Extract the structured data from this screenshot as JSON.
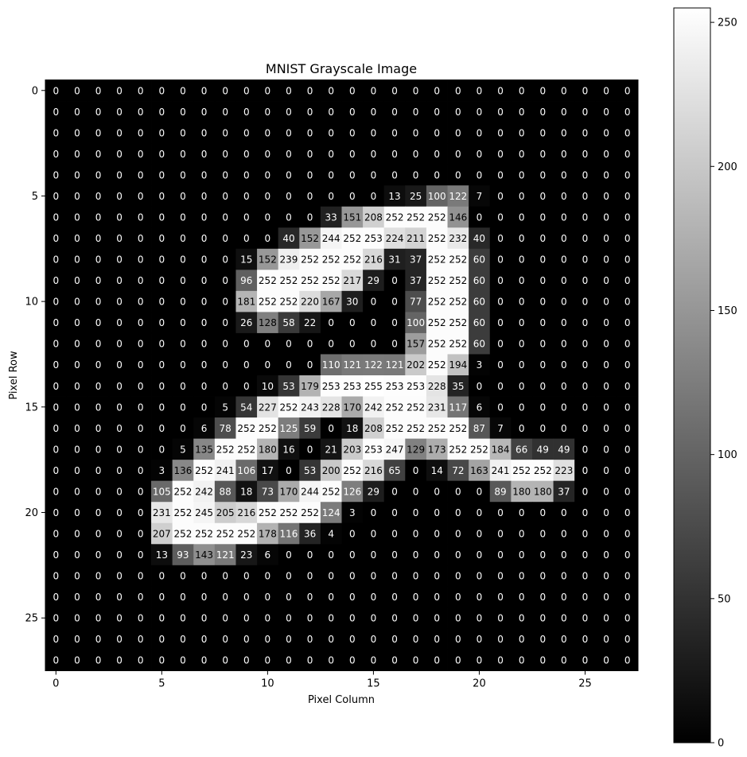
{
  "chart_data": {
    "type": "heatmap",
    "title": "MNIST Grayscale Image",
    "xlabel": "Pixel Column",
    "ylabel": "Pixel Row",
    "rows": 28,
    "cols": 28,
    "xticks": [
      0,
      5,
      10,
      15,
      20,
      25
    ],
    "yticks": [
      0,
      5,
      10,
      15,
      20,
      25
    ],
    "colorbar": {
      "min": 0,
      "max": 255,
      "ticks": [
        0,
        50,
        100,
        150,
        200,
        250
      ]
    },
    "colormap": "gray",
    "annotation_threshold": 127,
    "values": [
      [
        0,
        0,
        0,
        0,
        0,
        0,
        0,
        0,
        0,
        0,
        0,
        0,
        0,
        0,
        0,
        0,
        0,
        0,
        0,
        0,
        0,
        0,
        0,
        0,
        0,
        0,
        0,
        0
      ],
      [
        0,
        0,
        0,
        0,
        0,
        0,
        0,
        0,
        0,
        0,
        0,
        0,
        0,
        0,
        0,
        0,
        0,
        0,
        0,
        0,
        0,
        0,
        0,
        0,
        0,
        0,
        0,
        0
      ],
      [
        0,
        0,
        0,
        0,
        0,
        0,
        0,
        0,
        0,
        0,
        0,
        0,
        0,
        0,
        0,
        0,
        0,
        0,
        0,
        0,
        0,
        0,
        0,
        0,
        0,
        0,
        0,
        0
      ],
      [
        0,
        0,
        0,
        0,
        0,
        0,
        0,
        0,
        0,
        0,
        0,
        0,
        0,
        0,
        0,
        0,
        0,
        0,
        0,
        0,
        0,
        0,
        0,
        0,
        0,
        0,
        0,
        0
      ],
      [
        0,
        0,
        0,
        0,
        0,
        0,
        0,
        0,
        0,
        0,
        0,
        0,
        0,
        0,
        0,
        0,
        0,
        0,
        0,
        0,
        0,
        0,
        0,
        0,
        0,
        0,
        0,
        0
      ],
      [
        0,
        0,
        0,
        0,
        0,
        0,
        0,
        0,
        0,
        0,
        0,
        0,
        0,
        0,
        0,
        0,
        13,
        25,
        100,
        122,
        7,
        0,
        0,
        0,
        0,
        0,
        0,
        0
      ],
      [
        0,
        0,
        0,
        0,
        0,
        0,
        0,
        0,
        0,
        0,
        0,
        0,
        0,
        33,
        151,
        208,
        252,
        252,
        252,
        146,
        0,
        0,
        0,
        0,
        0,
        0,
        0,
        0
      ],
      [
        0,
        0,
        0,
        0,
        0,
        0,
        0,
        0,
        0,
        0,
        0,
        40,
        152,
        244,
        252,
        253,
        224,
        211,
        252,
        232,
        40,
        0,
        0,
        0,
        0,
        0,
        0,
        0
      ],
      [
        0,
        0,
        0,
        0,
        0,
        0,
        0,
        0,
        0,
        15,
        152,
        239,
        252,
        252,
        252,
        216,
        31,
        37,
        252,
        252,
        60,
        0,
        0,
        0,
        0,
        0,
        0,
        0
      ],
      [
        0,
        0,
        0,
        0,
        0,
        0,
        0,
        0,
        0,
        96,
        252,
        252,
        252,
        252,
        217,
        29,
        0,
        37,
        252,
        252,
        60,
        0,
        0,
        0,
        0,
        0,
        0,
        0
      ],
      [
        0,
        0,
        0,
        0,
        0,
        0,
        0,
        0,
        0,
        181,
        252,
        252,
        220,
        167,
        30,
        0,
        0,
        77,
        252,
        252,
        60,
        0,
        0,
        0,
        0,
        0,
        0,
        0
      ],
      [
        0,
        0,
        0,
        0,
        0,
        0,
        0,
        0,
        0,
        26,
        128,
        58,
        22,
        0,
        0,
        0,
        0,
        100,
        252,
        252,
        60,
        0,
        0,
        0,
        0,
        0,
        0,
        0
      ],
      [
        0,
        0,
        0,
        0,
        0,
        0,
        0,
        0,
        0,
        0,
        0,
        0,
        0,
        0,
        0,
        0,
        0,
        157,
        252,
        252,
        60,
        0,
        0,
        0,
        0,
        0,
        0,
        0
      ],
      [
        0,
        0,
        0,
        0,
        0,
        0,
        0,
        0,
        0,
        0,
        0,
        0,
        0,
        110,
        121,
        122,
        121,
        202,
        252,
        194,
        3,
        0,
        0,
        0,
        0,
        0,
        0,
        0
      ],
      [
        0,
        0,
        0,
        0,
        0,
        0,
        0,
        0,
        0,
        0,
        10,
        53,
        179,
        253,
        253,
        255,
        253,
        253,
        228,
        35,
        0,
        0,
        0,
        0,
        0,
        0,
        0,
        0
      ],
      [
        0,
        0,
        0,
        0,
        0,
        0,
        0,
        0,
        5,
        54,
        227,
        252,
        243,
        228,
        170,
        242,
        252,
        252,
        231,
        117,
        6,
        0,
        0,
        0,
        0,
        0,
        0,
        0
      ],
      [
        0,
        0,
        0,
        0,
        0,
        0,
        0,
        6,
        78,
        252,
        252,
        125,
        59,
        0,
        18,
        208,
        252,
        252,
        252,
        252,
        87,
        7,
        0,
        0,
        0,
        0,
        0,
        0
      ],
      [
        0,
        0,
        0,
        0,
        0,
        0,
        5,
        135,
        252,
        252,
        180,
        16,
        0,
        21,
        203,
        253,
        247,
        129,
        173,
        252,
        252,
        184,
        66,
        49,
        49,
        0,
        0,
        0
      ],
      [
        0,
        0,
        0,
        0,
        0,
        3,
        136,
        252,
        241,
        106,
        17,
        0,
        53,
        200,
        252,
        216,
        65,
        0,
        14,
        72,
        163,
        241,
        252,
        252,
        223,
        0,
        0,
        0
      ],
      [
        0,
        0,
        0,
        0,
        0,
        105,
        252,
        242,
        88,
        18,
        73,
        170,
        244,
        252,
        126,
        29,
        0,
        0,
        0,
        0,
        0,
        89,
        180,
        180,
        37,
        0,
        0,
        0
      ],
      [
        0,
        0,
        0,
        0,
        0,
        231,
        252,
        245,
        205,
        216,
        252,
        252,
        252,
        124,
        3,
        0,
        0,
        0,
        0,
        0,
        0,
        0,
        0,
        0,
        0,
        0,
        0,
        0
      ],
      [
        0,
        0,
        0,
        0,
        0,
        207,
        252,
        252,
        252,
        252,
        178,
        116,
        36,
        4,
        0,
        0,
        0,
        0,
        0,
        0,
        0,
        0,
        0,
        0,
        0,
        0,
        0,
        0
      ],
      [
        0,
        0,
        0,
        0,
        0,
        13,
        93,
        143,
        121,
        23,
        6,
        0,
        0,
        0,
        0,
        0,
        0,
        0,
        0,
        0,
        0,
        0,
        0,
        0,
        0,
        0,
        0,
        0
      ],
      [
        0,
        0,
        0,
        0,
        0,
        0,
        0,
        0,
        0,
        0,
        0,
        0,
        0,
        0,
        0,
        0,
        0,
        0,
        0,
        0,
        0,
        0,
        0,
        0,
        0,
        0,
        0,
        0
      ],
      [
        0,
        0,
        0,
        0,
        0,
        0,
        0,
        0,
        0,
        0,
        0,
        0,
        0,
        0,
        0,
        0,
        0,
        0,
        0,
        0,
        0,
        0,
        0,
        0,
        0,
        0,
        0,
        0
      ],
      [
        0,
        0,
        0,
        0,
        0,
        0,
        0,
        0,
        0,
        0,
        0,
        0,
        0,
        0,
        0,
        0,
        0,
        0,
        0,
        0,
        0,
        0,
        0,
        0,
        0,
        0,
        0,
        0
      ],
      [
        0,
        0,
        0,
        0,
        0,
        0,
        0,
        0,
        0,
        0,
        0,
        0,
        0,
        0,
        0,
        0,
        0,
        0,
        0,
        0,
        0,
        0,
        0,
        0,
        0,
        0,
        0,
        0
      ],
      [
        0,
        0,
        0,
        0,
        0,
        0,
        0,
        0,
        0,
        0,
        0,
        0,
        0,
        0,
        0,
        0,
        0,
        0,
        0,
        0,
        0,
        0,
        0,
        0,
        0,
        0,
        0,
        0
      ]
    ]
  }
}
